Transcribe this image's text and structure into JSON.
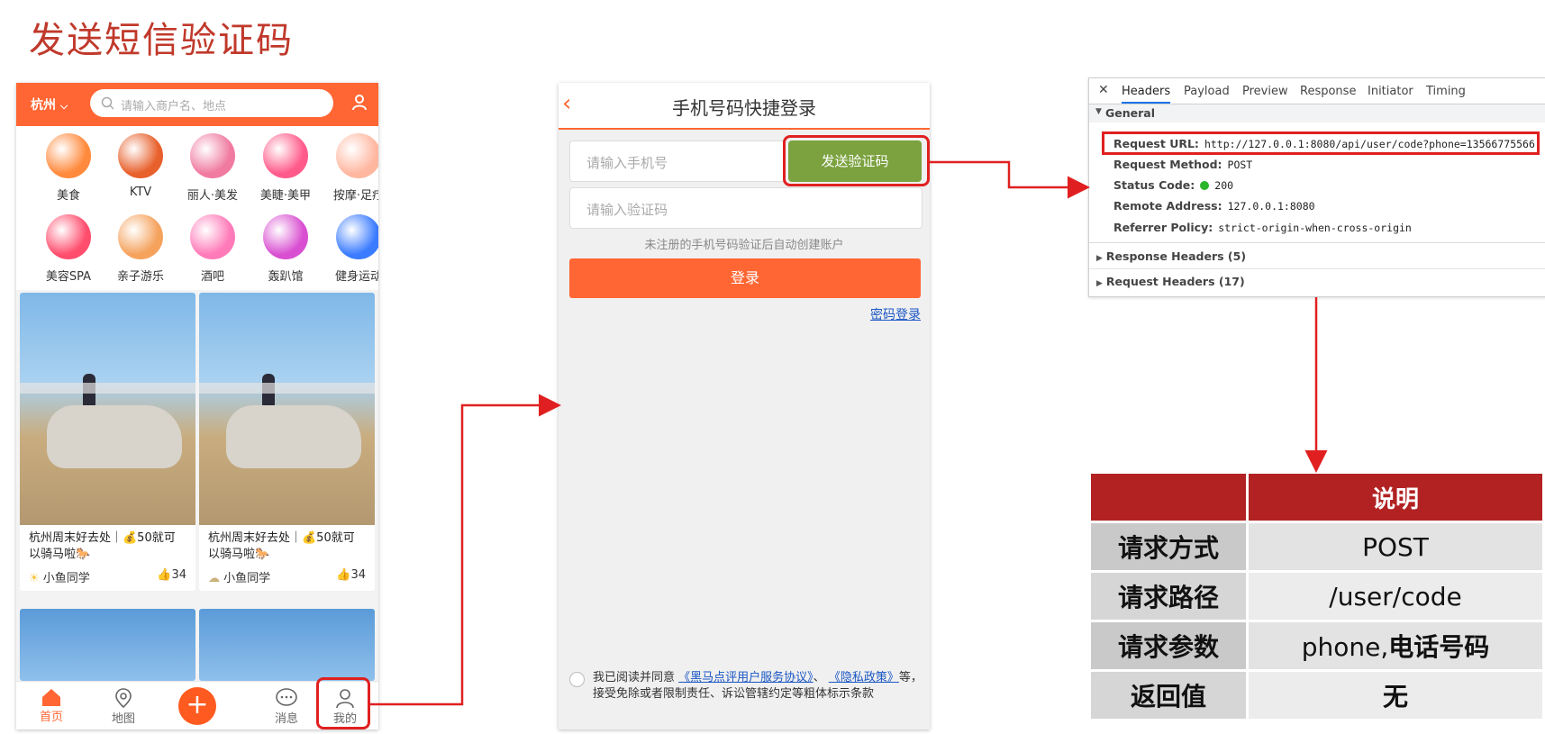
{
  "slide": {
    "title": "发送短信验证码"
  },
  "phone1": {
    "city": "杭州",
    "search_placeholder": "请输入商户名、地点",
    "categories": [
      {
        "label": "美食",
        "icon": "food-icon",
        "color": "#ff8a3d"
      },
      {
        "label": "KTV",
        "icon": "microphone-icon",
        "color": "#e8602c"
      },
      {
        "label": "丽人·美发",
        "icon": "hair-icon",
        "color": "#f07aa0"
      },
      {
        "label": "美睫·美甲",
        "icon": "nail-icon",
        "color": "#ff5b8a"
      },
      {
        "label": "按摩·足疗",
        "icon": "massage-icon",
        "color": "#ffb7a0"
      },
      {
        "label": "美容SPA",
        "icon": "mask-icon",
        "color": "#ff4d6d"
      },
      {
        "label": "亲子游乐",
        "icon": "family-icon",
        "color": "#f5a25d"
      },
      {
        "label": "酒吧",
        "icon": "cocktail-icon",
        "color": "#ff7ab8"
      },
      {
        "label": "轰趴馆",
        "icon": "party-mask-icon",
        "color": "#d94fd1"
      },
      {
        "label": "健身运动",
        "icon": "dumbbell-icon",
        "color": "#3a7bff"
      }
    ],
    "posts": [
      {
        "title": "杭州周末好去处｜💰50就可以骑马啦🐎",
        "author": "小鱼同学",
        "likes": "34"
      },
      {
        "title": "杭州周末好去处｜💰50就可以骑马啦🐎",
        "author": "小鱼同学",
        "likes": "34"
      }
    ],
    "tabs": [
      {
        "label": "首页",
        "icon": "home-icon"
      },
      {
        "label": "地图",
        "icon": "map-pin-icon"
      },
      {
        "label": "",
        "icon": "plus-icon"
      },
      {
        "label": "消息",
        "icon": "message-icon"
      },
      {
        "label": "我的",
        "icon": "user-icon"
      }
    ],
    "colors": {
      "accent": "#ff6633"
    }
  },
  "phone2": {
    "title": "手机号码快捷登录",
    "phone_placeholder": "请输入手机号",
    "send_code_label": "发送验证码",
    "code_placeholder": "请输入验证码",
    "hint": "未注册的手机号码验证后自动创建账户",
    "login_label": "登录",
    "password_login": "密码登录",
    "agree_prefix": "我已阅读并同意",
    "agree_link1": "《黑马点评用户服务协议》",
    "agree_sep": "、",
    "agree_link2": "《隐私政策》",
    "agree_suffix": "等，接受免除或者限制责任、诉讼管辖约定等粗体标示条款",
    "colors": {
      "send_button": "#7ba23f",
      "login_button": "#ff6633"
    }
  },
  "devtools": {
    "tabs": [
      "Headers",
      "Payload",
      "Preview",
      "Response",
      "Initiator",
      "Timing"
    ],
    "active_tab": "Headers",
    "general_label": "General",
    "rows": [
      {
        "key": "Request URL:",
        "value": "http://127.0.0.1:8080/api/user/code?phone=13566775566"
      },
      {
        "key": "Request Method:",
        "value": "POST"
      },
      {
        "key": "Status Code:",
        "value": "200"
      },
      {
        "key": "Remote Address:",
        "value": "127.0.0.1:8080"
      },
      {
        "key": "Referrer Policy:",
        "value": "strict-origin-when-cross-origin"
      }
    ],
    "response_headers": "Response Headers (5)",
    "request_headers": "Request Headers (17)"
  },
  "api_table": {
    "header": "说明",
    "rows": [
      {
        "key": "请求方式",
        "value": "POST"
      },
      {
        "key": "请求路径",
        "value": "/user/code"
      },
      {
        "key": "请求参数",
        "value_plain": "phone,",
        "value_bold": "电话号码"
      },
      {
        "key": "返回值",
        "value_bold": "无"
      }
    ]
  }
}
